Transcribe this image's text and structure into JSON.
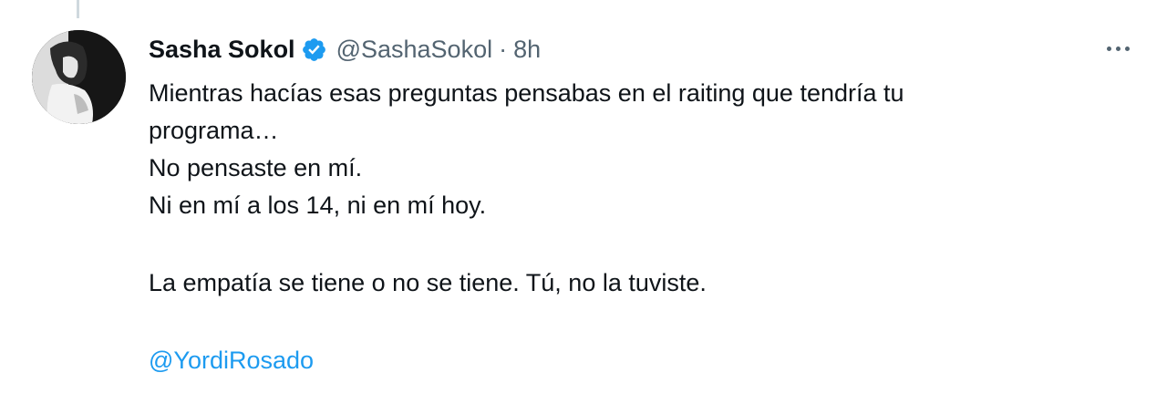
{
  "tweet": {
    "author_name": "Sasha Sokol",
    "handle": "@SashaSokol",
    "separator": "·",
    "time": "8h",
    "lines": [
      "Mientras hacías esas preguntas pensabas en el raiting que tendría tu",
      "programa…",
      "No pensaste en mí.",
      "Ni en mí a los 14, ni en mí hoy."
    ],
    "paragraph2": "La empatía se tiene o no se tiene. Tú, no la tuviste.",
    "mention": "@YordiRosado"
  },
  "icons": {
    "verified": "verified-badge-icon",
    "more": "more-options-icon"
  },
  "colors": {
    "accent": "#1d9bf0",
    "secondary_text": "#536471",
    "primary_text": "#0f1419",
    "thread_line": "#cfd9de"
  }
}
